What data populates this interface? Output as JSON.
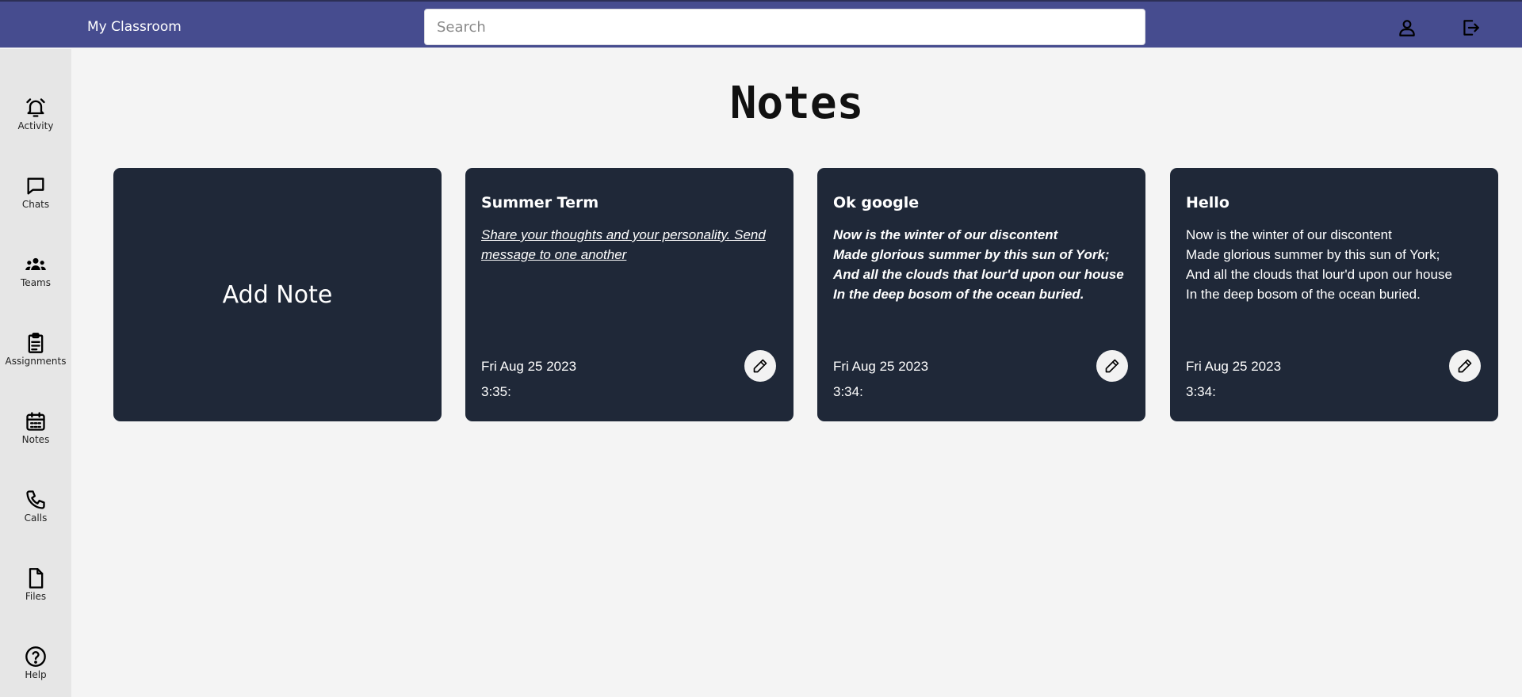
{
  "header": {
    "app_title": "My Classroom",
    "search_placeholder": "Search",
    "search_value": "",
    "icons": [
      "user-icon",
      "logout-icon"
    ]
  },
  "sidebar": {
    "items": [
      {
        "label": "Activity",
        "icon": "bell-icon"
      },
      {
        "label": "Chats",
        "icon": "chat-icon"
      },
      {
        "label": "Teams",
        "icon": "teams-icon"
      },
      {
        "label": "Assignments",
        "icon": "clipboard-icon"
      },
      {
        "label": "Notes",
        "icon": "calendar-icon"
      },
      {
        "label": "Calls",
        "icon": "phone-icon"
      },
      {
        "label": "Files",
        "icon": "file-icon"
      },
      {
        "label": "Help",
        "icon": "help-icon"
      }
    ]
  },
  "main": {
    "title": "Notes",
    "add_note_label": "Add Note",
    "notes": [
      {
        "title": "Summer Term",
        "body": "Share your thoughts and your personality. Send message to one another",
        "date": "Fri Aug 25 2023",
        "time": "3:35:",
        "style": "italic-underline"
      },
      {
        "title": "Ok google",
        "body": "Now is the winter of our discontent\nMade glorious summer by this sun of York;\nAnd all the clouds that lour'd upon our house\nIn the deep bosom of the ocean buried.",
        "date": "Fri Aug 25 2023",
        "time": "3:34:",
        "style": "bold-italic"
      },
      {
        "title": "Hello",
        "body": "Now is the winter of our discontent\nMade glorious summer by this sun of York;\nAnd all the clouds that lour'd upon our house\nIn the deep bosom of the ocean buried.",
        "date": "Fri Aug 25 2023",
        "time": "3:34:",
        "style": "normal"
      }
    ]
  },
  "colors": {
    "header_bg": "#464c8f",
    "sidebar_bg": "#e6e6e6",
    "card_bg": "#1f2838",
    "page_bg": "#f4f4f4"
  }
}
